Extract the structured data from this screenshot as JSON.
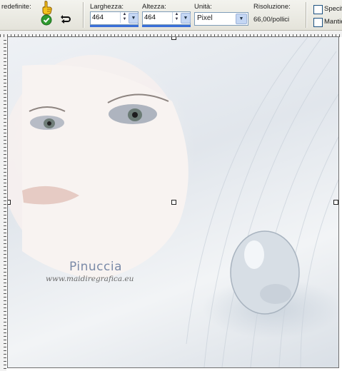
{
  "toolbar": {
    "presets_label": "redefinite:",
    "width_label": "Larghezza:",
    "width_value": "464",
    "height_label": "Altezza:",
    "height_value": "464",
    "units_label": "Unità:",
    "units_value": "Pixel",
    "resolution_label": "Risoluzione:",
    "resolution_value": "66,00/pollici",
    "specify_label": "Specif",
    "maintain_label": "Mantie"
  },
  "icons": {
    "apply": "check-circle-icon",
    "reset": "undo-arrow-icon",
    "pointer": "pointing-hand-icon"
  },
  "canvas": {
    "watermark_name": "Pinuccia",
    "watermark_url": "www.maidiregrafica.eu"
  },
  "colors": {
    "accent": "#3a6fd8",
    "apply_green": "#2f9a2f",
    "hand_yellow": "#f3c21c"
  }
}
